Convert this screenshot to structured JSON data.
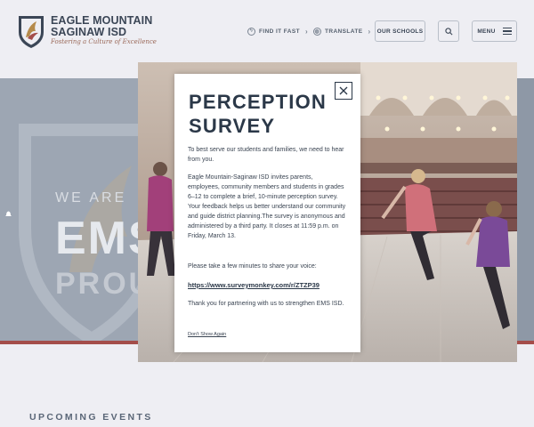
{
  "header": {
    "brand_line1": "EAGLE MOUNTAIN",
    "brand_line2": "SAGINAW ISD",
    "tagline": "Fostering a Culture of Excellence",
    "find_it_fast": "FIND IT FAST",
    "translate": "TRANSLATE",
    "our_schools": "OUR SCHOOLS",
    "menu": "MENU"
  },
  "hero": {
    "we_are": "WE ARE",
    "ems": "EMS",
    "proud": "PROUD"
  },
  "modal": {
    "title": "PERCEPTION SURVEY",
    "p1": "To best serve our students and families, we need to hear from you.",
    "p2": "Eagle Mountain-Saginaw ISD invites parents, employees, community members and students in grades 6–12 to complete a brief, 10-minute perception survey. Your feedback helps us better understand our community and guide district planning.The survey is anonymous and administered by a third party. It closes at 11:59 p.m. on Friday, March 13.",
    "p3": "Please take a few minutes to share your voice:",
    "link": "https://www.surveymonkey.com/r/ZTZP39",
    "p4": "Thank you for partnering with us to strengthen EMS ISD.",
    "dont_show": "Don't Show Again"
  },
  "sections": {
    "upcoming_events": "UPCOMING EVENTS"
  },
  "icons": {
    "logo": "eagle-shield-logo",
    "find_it_fast": "lightning-icon",
    "translate": "globe-icon",
    "search": "search-icon",
    "menu": "hamburger-icon",
    "close": "close-icon",
    "alert": "bell-icon"
  },
  "colors": {
    "navy": "#2b3848",
    "accent_red": "#a44d4a",
    "tagline": "#9b6a5a"
  }
}
